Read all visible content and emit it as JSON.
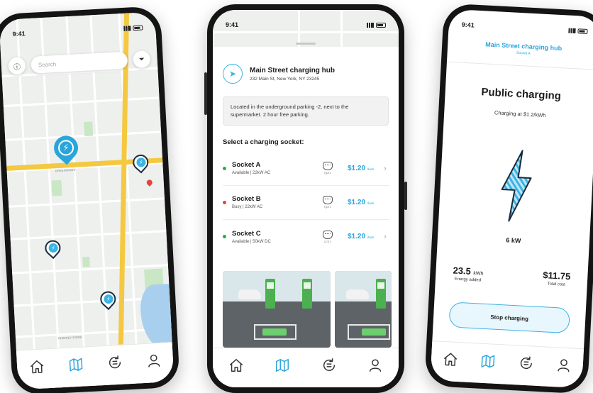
{
  "status_time": "9:41",
  "map_screen": {
    "search_placeholder": "Search",
    "labels": [
      "GREENWOOD",
      "PHINNEY RIDGE"
    ],
    "active_tab": "map"
  },
  "station_screen": {
    "hub_title": "Main Street charging hub",
    "hub_address": "232 Main St, New York, NY 23245",
    "note": "Located in the underground parking -2, next to the supermarket. 2 hour free parking.",
    "section_title": "Select a charging socket:",
    "sockets": [
      {
        "name": "Socket A",
        "status": "Available | 22kW AC",
        "status_color": "#22b14c",
        "plug": "Type 2",
        "price": "$1.20",
        "unit": "/kwh"
      },
      {
        "name": "Socket B",
        "status": "Busy | 22kW AC",
        "status_color": "#e0463c",
        "plug": "Type 2",
        "price": "$1.20",
        "unit": "/kwh"
      },
      {
        "name": "Socket C",
        "status": "Available | 50kW DC",
        "status_color": "#22b14c",
        "plug": "CCS 2",
        "price": "$1.20",
        "unit": "/kwh"
      }
    ]
  },
  "charging_screen": {
    "header_title": "Main Street charging hub",
    "header_sub": "Socket A",
    "title": "Public charging",
    "rate": "Charging at $1.2/kWh",
    "power": "6 kW",
    "energy_value": "23.5",
    "energy_unit": "kWh",
    "energy_label": "Energy added",
    "cost_value": "$11.75",
    "cost_label": "Total cost",
    "stop_label": "Stop charging"
  },
  "colors": {
    "accent": "#2aa5dc",
    "available": "#22b14c",
    "busy": "#e0463c"
  }
}
